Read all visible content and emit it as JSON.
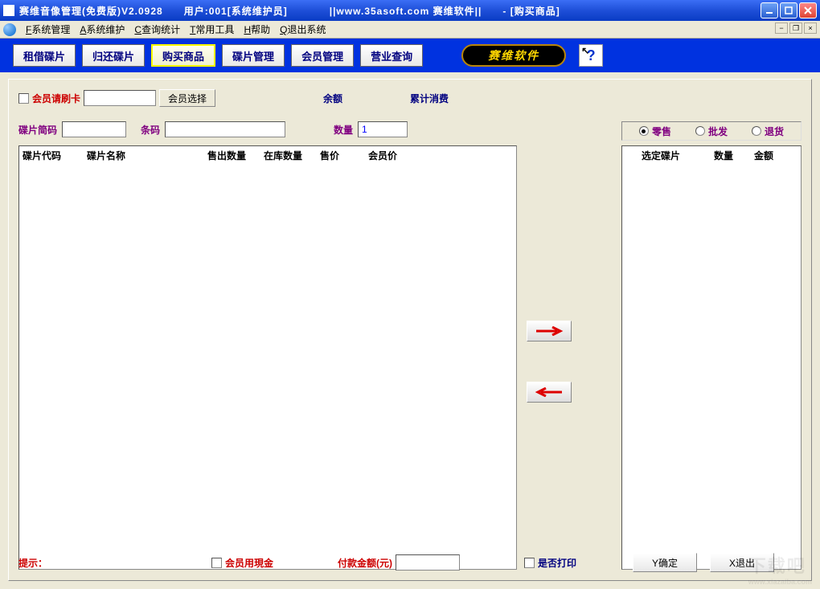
{
  "titlebar": {
    "text": "赛维音像管理(免费版)V2.0928　　用户:001[系统维护员]　　　　||www.35asoft.com 赛维软件||　　- [购买商品]"
  },
  "menus": [
    {
      "u": "F",
      "label": "系统管理"
    },
    {
      "u": "A",
      "label": "系统维护"
    },
    {
      "u": "C",
      "label": "查询统计"
    },
    {
      "u": "T",
      "label": "常用工具"
    },
    {
      "u": "H",
      "label": "帮助"
    },
    {
      "u": "Q",
      "label": "退出系统"
    }
  ],
  "toolbar": {
    "rent": "租借碟片",
    "return": "归还碟片",
    "buy": "购买商品",
    "disc": "碟片管理",
    "member": "会员管理",
    "biz": "营业查询",
    "brand": "赛维软件"
  },
  "form": {
    "member_swipe": "会员请刷卡",
    "member_select": "会员选择",
    "balance": "余额",
    "total_spent": "累计消费",
    "disc_code": "碟片简码",
    "barcode": "条码",
    "qty": "数量",
    "qty_val": "1"
  },
  "radios": {
    "retail": "零售",
    "wholesale": "批发",
    "return": "退货"
  },
  "grid_left_headers": [
    "碟片代码",
    "碟片名称",
    "售出数量",
    "在库数量",
    "售价",
    "会员价"
  ],
  "grid_right_headers": [
    "选定碟片",
    "数量",
    "金额"
  ],
  "footer": {
    "tip": "提示：",
    "cash": "会员用現金",
    "pay": "付款金额(元)",
    "print": "是否打印",
    "confirm": "Y确定",
    "exit": "X退出"
  },
  "watermark": {
    "big": "下载吧",
    "small": "www.xiazaiba.com"
  }
}
